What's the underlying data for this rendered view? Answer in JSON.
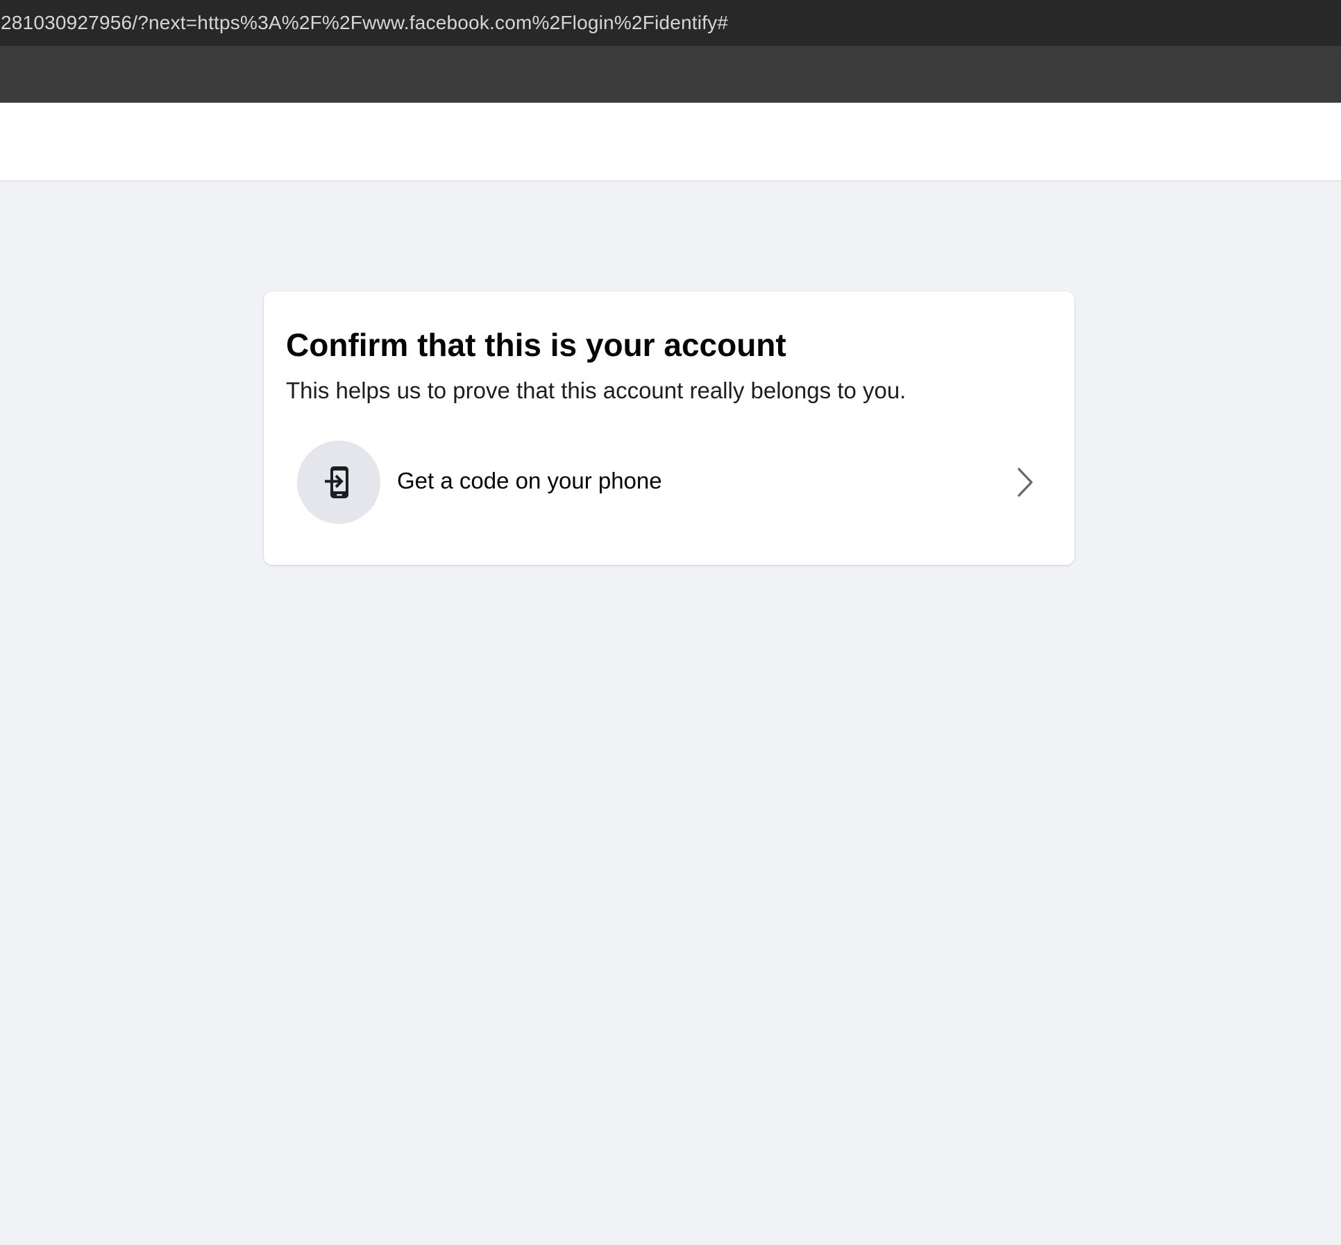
{
  "browser": {
    "url": "281030927956/?next=https%3A%2F%2Fwww.facebook.com%2Flogin%2Fidentify#"
  },
  "card": {
    "title": "Confirm that this is your account",
    "subtitle": "This helps us to prove that this account really belongs to you.",
    "options": [
      {
        "label": "Get a code on your phone",
        "icon": "phone-code-icon",
        "trailing_icon": "chevron-right-icon"
      }
    ]
  },
  "colors": {
    "page_background": "#f0f2f5",
    "url_bar": "#282828",
    "toolbar": "#3c3c3c",
    "card_background": "#ffffff",
    "icon_circle": "#e4e6eb",
    "text_primary": "#050505"
  }
}
